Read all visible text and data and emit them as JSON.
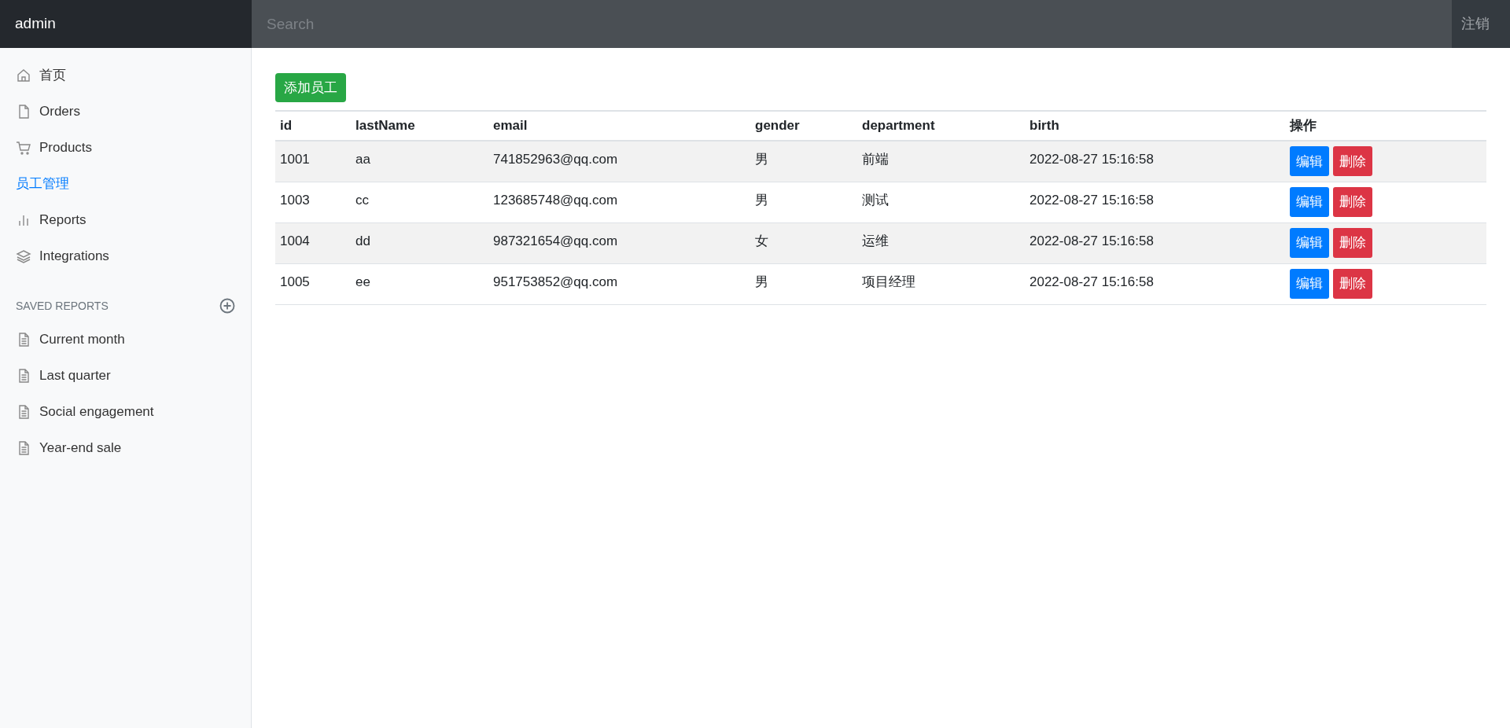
{
  "navbar": {
    "brand": "admin",
    "search": {
      "placeholder": "Search"
    },
    "signout": "注销"
  },
  "sidebar": {
    "items": [
      {
        "label": "首页",
        "kind": "home",
        "selected": false
      },
      {
        "label": "Orders",
        "kind": "file",
        "selected": false
      },
      {
        "label": "Products",
        "kind": "cart",
        "selected": false
      },
      {
        "label": "员工管理",
        "kind": "none",
        "selected": true
      },
      {
        "label": "Reports",
        "kind": "bars",
        "selected": false
      },
      {
        "label": "Integrations",
        "kind": "layers",
        "selected": false
      }
    ],
    "saved_reports": {
      "heading": "SAVED REPORTS",
      "items": [
        "Current month",
        "Last quarter",
        "Social engagement",
        "Year-end sale"
      ]
    }
  },
  "add_button": "添加员工",
  "table": {
    "columns": [
      "id",
      "lastName",
      "email",
      "gender",
      "department",
      "birth",
      "操作"
    ],
    "rows": [
      {
        "cells": [
          "1001",
          "aa",
          "741852963@qq.com",
          "男",
          "前端",
          "2022-08-27 15:16:58"
        ],
        "actions": [
          "编辑",
          "删除"
        ]
      },
      {
        "cells": [
          "1003",
          "cc",
          "123685748@qq.com",
          "男",
          "测试",
          "2022-08-27 15:16:58"
        ],
        "actions": [
          "编辑",
          "删除"
        ]
      },
      {
        "cells": [
          "1004",
          "dd",
          "987321654@qq.com",
          "女",
          "运维",
          "2022-08-27 15:16:58"
        ],
        "actions": [
          "编辑",
          "删除"
        ]
      },
      {
        "cells": [
          "1005",
          "ee",
          "951753852@qq.com",
          "男",
          "项目经理",
          "2022-08-27 15:16:58"
        ],
        "actions": [
          "编辑",
          "删除"
        ]
      }
    ]
  }
}
